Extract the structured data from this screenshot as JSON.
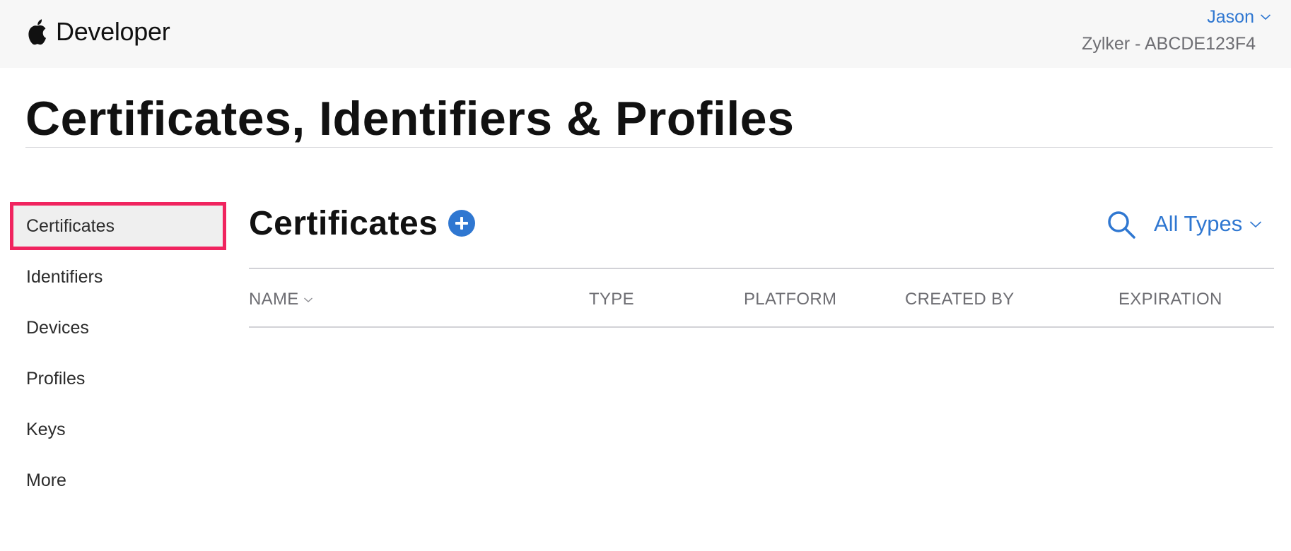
{
  "header": {
    "brand": "Developer",
    "user": "Jason",
    "team": "Zylker - ABCDE123F4"
  },
  "page": {
    "title": "Certificates, Identifiers & Profiles"
  },
  "sidebar": {
    "items": [
      {
        "label": "Certificates",
        "active": true
      },
      {
        "label": "Identifiers"
      },
      {
        "label": "Devices"
      },
      {
        "label": "Profiles"
      },
      {
        "label": "Keys"
      },
      {
        "label": "More"
      }
    ]
  },
  "main": {
    "section_title": "Certificates",
    "filter_label": "All Types",
    "columns": [
      "NAME",
      "TYPE",
      "PLATFORM",
      "CREATED BY",
      "EXPIRATION"
    ]
  },
  "colors": {
    "accent": "#2f77d1",
    "highlight_border": "#f0245f",
    "active_item_bg": "#efefef",
    "header_bg": "#f7f7f7"
  },
  "icons": {
    "brand": "apple-logo-icon",
    "user_menu": "chevron-down-icon",
    "add": "plus-circle-icon",
    "search": "search-icon",
    "filter": "chevron-down-icon",
    "sort": "chevron-down-icon"
  }
}
